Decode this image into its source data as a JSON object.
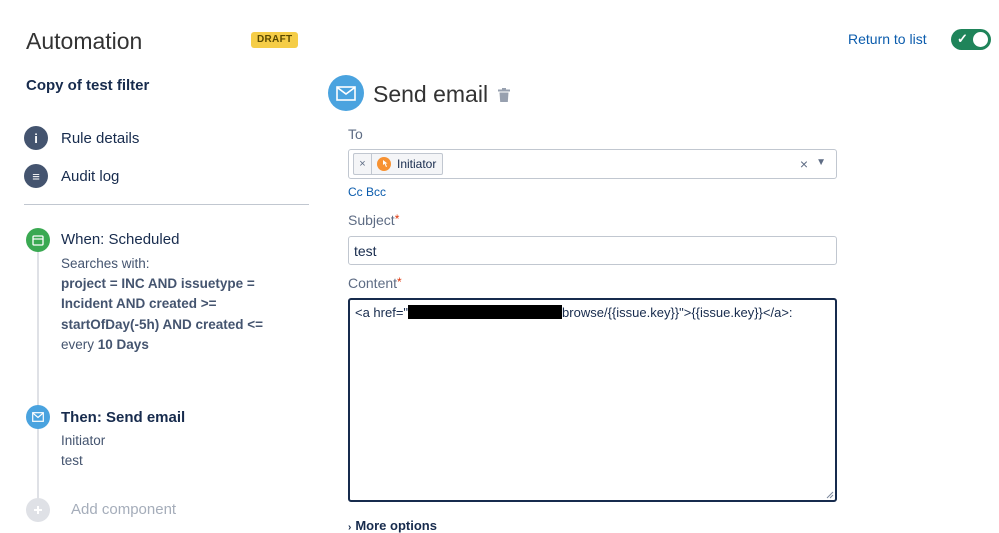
{
  "header": {
    "title": "Automation",
    "status_badge": "DRAFT",
    "return_link": "Return to list",
    "toggle_checkmark": "✓"
  },
  "sidebar": {
    "rule_name": "Copy of test filter",
    "nav": [
      {
        "label": "Rule details",
        "icon": "info-icon",
        "glyph": "i"
      },
      {
        "label": "Audit log",
        "icon": "list-icon",
        "glyph": "≡"
      }
    ],
    "trigger": {
      "title": "When: Scheduled",
      "searches_with": "Searches with:",
      "jql_lines": [
        "project = INC AND issuetype =",
        "Incident AND created >=",
        "startOfDay(-5h) AND created <="
      ],
      "every_prefix": "every",
      "every_value": "10 Days"
    },
    "action": {
      "title": "Then: Send email",
      "lines": [
        "Initiator",
        "test"
      ]
    },
    "add_component": "Add component"
  },
  "editor": {
    "title": "Send email",
    "to": {
      "label": "To",
      "chip_remove": "×",
      "chip": "Initiator",
      "clear": "×",
      "caret": "▼"
    },
    "cc_bcc": "Cc Bcc",
    "subject": {
      "label": "Subject",
      "required_mark": "*",
      "value": "test"
    },
    "content": {
      "label": "Content",
      "required_mark": "*",
      "prefix": "<a href=\"",
      "suffix": "browse/{{issue.key}}\">{{issue.key}}</a>:"
    },
    "more_options": "More options",
    "more_options_chevron": "›"
  },
  "colors": {
    "accent_link": "#0b5cad",
    "toggle_on": "#1f845a",
    "draft_badge": "#f5cd47",
    "trigger_green": "#3aa952",
    "action_blue": "#4aa3df",
    "required_red": "#de350b"
  }
}
